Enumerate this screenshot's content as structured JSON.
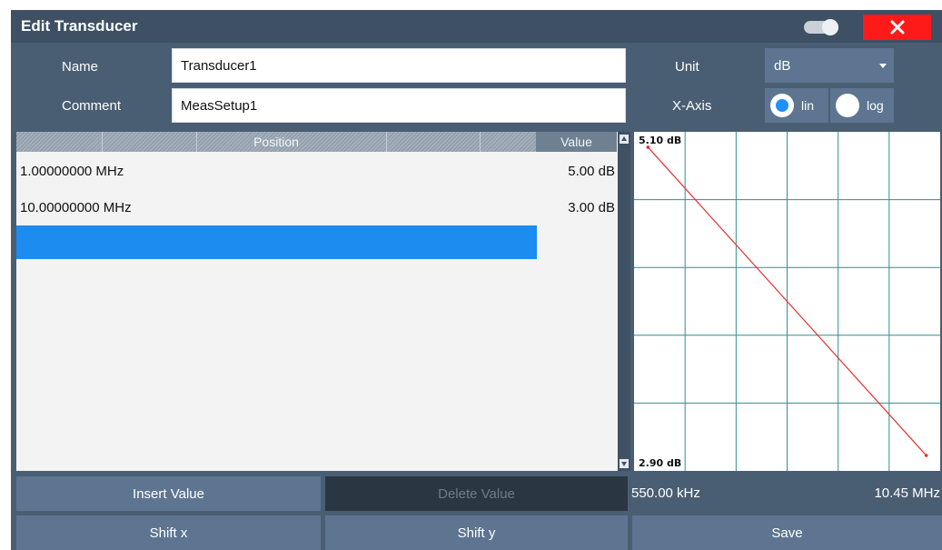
{
  "dialog": {
    "title": "Edit Transducer"
  },
  "form": {
    "name_label": "Name",
    "name_value": "Transducer1",
    "comment_label": "Comment",
    "comment_value": "MeasSetup1",
    "unit_label": "Unit",
    "unit_value": "dB",
    "xaxis_label": "X-Axis",
    "xaxis_options": [
      "lin",
      "log"
    ],
    "xaxis_selected": "lin"
  },
  "table": {
    "columns": [
      "Position",
      "Value"
    ],
    "rows": [
      {
        "position": "1.00000000 MHz",
        "value": "5.00 dB"
      },
      {
        "position": "10.00000000 MHz",
        "value": "3.00 dB"
      }
    ]
  },
  "chart_data": {
    "type": "line",
    "x": [
      1.0,
      10.0
    ],
    "y": [
      5.0,
      3.0
    ],
    "xlim": [
      0.55,
      10.45
    ],
    "ylim": [
      2.9,
      5.1
    ],
    "grid": true,
    "y_top_label": "5.10 dB",
    "y_bottom_label": "2.90 dB",
    "x_left_label": "550.00 kHz",
    "x_right_label": "10.45 MHz",
    "line_color": "#e83030",
    "grid_color": "#2f8f8f"
  },
  "buttons": {
    "insert_value": "Insert Value",
    "delete_value": "Delete Value",
    "shift_x": "Shift x",
    "shift_y": "Shift y",
    "save": "Save"
  },
  "icons": {
    "close": "close-icon",
    "toggle": "toggle-icon"
  },
  "colors": {
    "accent": "#1c8cf0",
    "close": "#ff1a1a"
  }
}
